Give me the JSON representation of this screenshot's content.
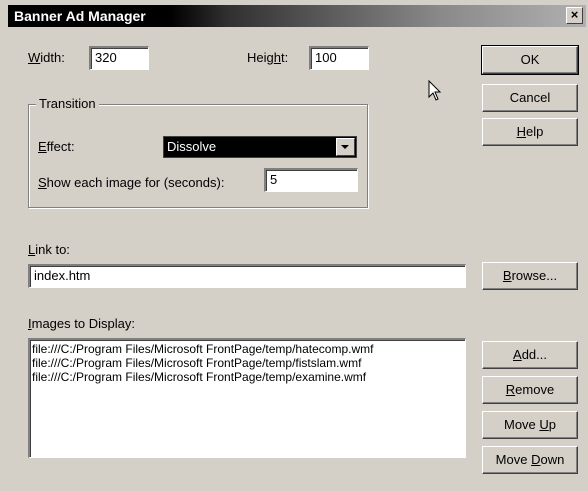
{
  "window": {
    "title": "Banner Ad Manager",
    "close_glyph": "×"
  },
  "width": {
    "label": "Width:",
    "value": "320"
  },
  "height": {
    "label": "Height:",
    "value": "100"
  },
  "transition": {
    "caption": "Transition",
    "effect_label": "Effect:",
    "effect_value": "Dissolve",
    "show_label": "Show each image for (seconds):",
    "show_value": "5"
  },
  "link": {
    "label": "Link to:",
    "value": "index.htm"
  },
  "images": {
    "label": "Images to Display:",
    "items": [
      "file:///C:/Program Files/Microsoft FrontPage/temp/hatecomp.wmf",
      "file:///C:/Program Files/Microsoft FrontPage/temp/fistslam.wmf",
      "file:///C:/Program Files/Microsoft FrontPage/temp/examine.wmf"
    ]
  },
  "buttons": {
    "ok": "OK",
    "cancel": "Cancel",
    "help": "Help",
    "browse": "Browse...",
    "add": "Add...",
    "remove": "Remove",
    "move_up": "Move Up",
    "move_down": "Move Down"
  },
  "icons": {
    "cursor": "mouse-pointer-icon",
    "dropdown": "chevron-down-icon",
    "close": "close-icon"
  }
}
